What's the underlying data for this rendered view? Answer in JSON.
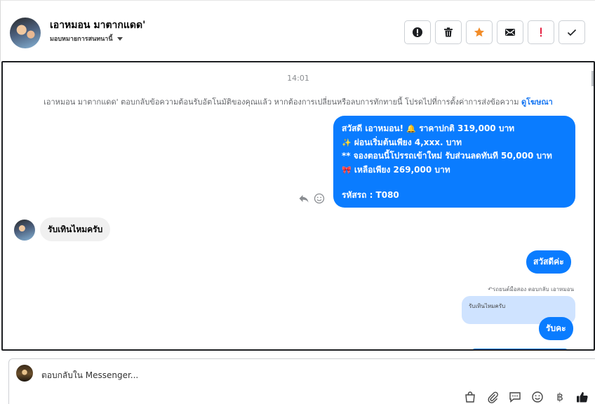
{
  "header": {
    "contact_name": "เอาหมอน มาตากแดด'",
    "assign_label": "มอบหมายการสนทนานี้",
    "actions": [
      {
        "name": "report-button",
        "icon": "alert-circle-icon"
      },
      {
        "name": "delete-button",
        "icon": "trash-icon"
      },
      {
        "name": "star-button",
        "icon": "star-icon"
      },
      {
        "name": "mark-unread-button",
        "icon": "envelope-icon"
      },
      {
        "name": "important-button",
        "icon": "exclamation-icon"
      },
      {
        "name": "done-button",
        "icon": "checkmark-icon"
      }
    ],
    "colors": {
      "star": "#f28c28",
      "important": "#e41e3f"
    }
  },
  "conversation": {
    "timestamp": "14:01",
    "notice_text": "เอาหมอน มาตากแดด' ตอบกลับข้อความต้อนรับอัตโนมัติของคุณแล้ว หากต้องการเปลี่ยนหรือลบการทักทายนี้ โปรดไปที่การตั้งค่าการส่งข้อความ",
    "notice_link": "ดูโฆษณา",
    "promo_message": {
      "line1_text": "สวัสดี เอาหมอน!",
      "line1_emoji": "🔔",
      "line1_price": "ราคาปกติ  319,000 บาท",
      "line2_emoji": "✨",
      "line2_text": "ผ่อนเริ่มต้นเพียง 4,xxx. บาท",
      "line3_text": "** จองตอนนี้โปรรถเข้าใหม่ รับส่วนลดทันที 50,000 บาท",
      "line4_emoji": "🎀",
      "line4_text": "เหลือเพียง 269,000 บาท",
      "line5_text": "รหัสรถ : T080"
    },
    "incoming_message": "รับเทินไหมครับ",
    "reply_hi": "สวัสดีค่ะ",
    "reply_meta": "รถยนต์มือสอง ตอบกลับ เอาหมอน",
    "quoted_text": "รับเทินไหมครับ",
    "reply_ok": "รับคะ",
    "bubble_color": "#0a7cff"
  },
  "composer": {
    "placeholder": "ตอบกลับใน Messenger...",
    "tools": [
      "bag-icon",
      "paperclip-icon",
      "message-bubble-icon",
      "smile-icon",
      "baht-icon",
      "thumbs-up-icon"
    ],
    "baht_symbol": "฿"
  }
}
